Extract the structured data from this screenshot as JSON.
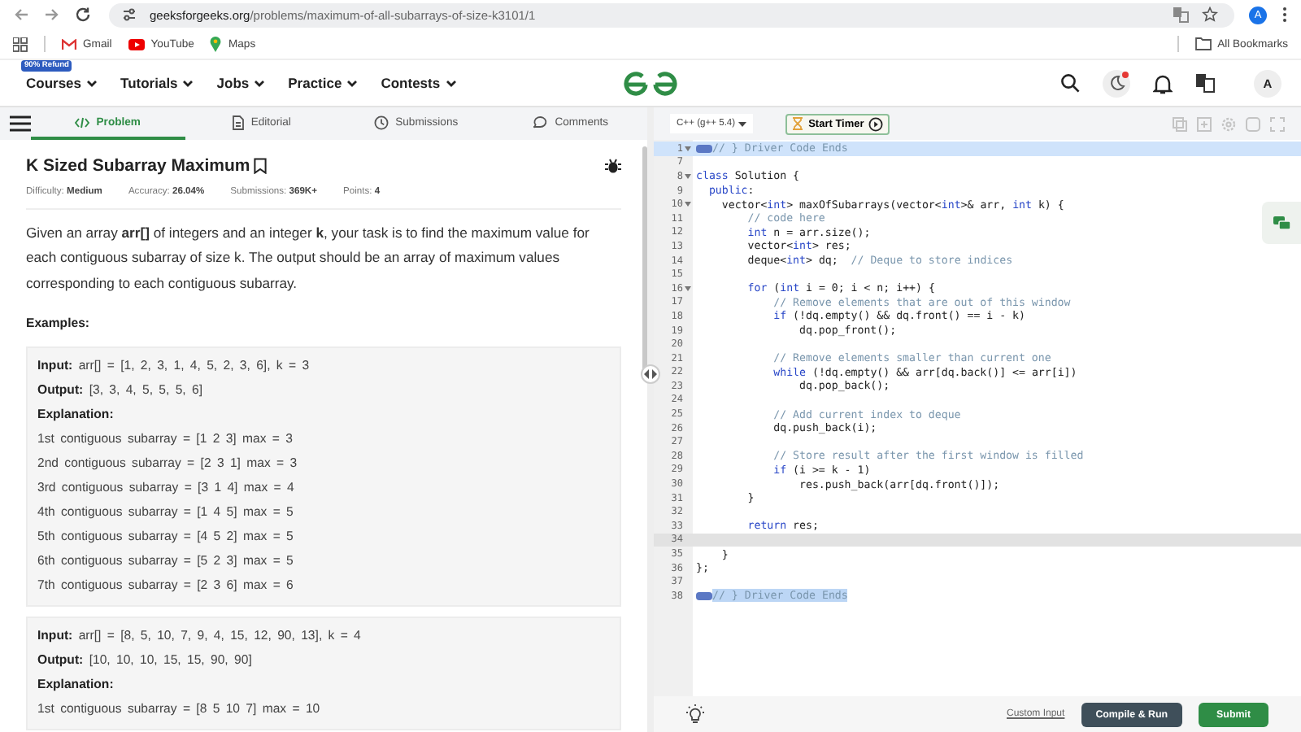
{
  "browser": {
    "url_host": "geeksforgeeks.org",
    "url_path": "/problems/maximum-of-all-subarrays-of-size-k3101/1",
    "profile_initial": "A"
  },
  "bookmarks": [
    {
      "label": "Gmail",
      "kind": "gmail"
    },
    {
      "label": "YouTube",
      "kind": "youtube"
    },
    {
      "label": "Maps",
      "kind": "maps"
    }
  ],
  "all_bookmarks": "All Bookmarks",
  "site_nav": {
    "badge": "90% Refund",
    "menus": [
      "Courses",
      "Tutorials",
      "Jobs",
      "Practice",
      "Contests"
    ],
    "notification_dot": true,
    "avatar": "A"
  },
  "problem_tabs": [
    {
      "label": "Problem",
      "kind": "code",
      "selected": true
    },
    {
      "label": "Editorial",
      "kind": "doc",
      "selected": false
    },
    {
      "label": "Submissions",
      "kind": "clock",
      "selected": false
    },
    {
      "label": "Comments",
      "kind": "chat",
      "selected": false
    }
  ],
  "problem": {
    "title": "K Sized Subarray Maximum",
    "meta": [
      {
        "label": "Difficulty:",
        "value": "Medium"
      },
      {
        "label": "Accuracy:",
        "value": "26.04%"
      },
      {
        "label": "Submissions:",
        "value": "369K+"
      },
      {
        "label": "Points:",
        "value": "4"
      }
    ],
    "description": "Given an array **arr[]** of integers and an integer **k**, your task is to find the maximum value for each contiguous subarray of size k. The output should be an array of maximum values corresponding to each contiguous subarray.",
    "examples_heading": "Examples:",
    "examples": [
      {
        "input_label": "Input:",
        "input": "arr[] = [1, 2, 3, 1, 4, 5, 2, 3, 6], k = 3",
        "output_label": "Output:",
        "output": "[3, 3, 4, 5, 5, 5, 6]",
        "explanation_label": "Explanation:",
        "explanation": [
          "1st contiguous subarray = [1 2 3] max = 3",
          "2nd contiguous subarray = [2 3 1] max = 3",
          "3rd contiguous subarray = [3 1 4] max = 4",
          "4th contiguous subarray = [1 4 5] max = 5",
          "5th contiguous subarray = [4 5 2] max = 5",
          "6th contiguous subarray = [5 2 3] max = 5",
          "7th contiguous subarray = [2 3 6] max = 6"
        ]
      },
      {
        "input_label": "Input:",
        "input": "arr[] = [8, 5, 10, 7, 9, 4, 15, 12, 90, 13], k = 4",
        "output_label": "Output:",
        "output": "[10, 10, 10, 15, 15, 90, 90]",
        "explanation_label": "Explanation:",
        "explanation": [
          "1st contiguous subarray = [8 5 10 7] max = 10"
        ]
      }
    ]
  },
  "editor": {
    "language": "C++ (g++ 5.4)",
    "timer_button": "Start Timer",
    "lines": [
      {
        "number": "1",
        "fold": true,
        "folded": true,
        "selected": true,
        "active": true,
        "parts": [
          {
            "kind": "comment",
            "text": "// } Driver Code Ends"
          }
        ]
      },
      {
        "number": "7",
        "fold": false,
        "folded": false,
        "selected": false,
        "active": false
      },
      {
        "number": "8",
        "fold": true,
        "folded": false,
        "selected": false,
        "active": false,
        "parts": [
          {
            "kind": "keyword",
            "text": "class"
          },
          {
            "kind": "plain",
            "text": " Solution {"
          }
        ]
      },
      {
        "number": "9",
        "fold": false,
        "folded": false,
        "selected": false,
        "active": false,
        "parts": [
          {
            "kind": "keyword",
            "text": "  public"
          },
          {
            "kind": "plain",
            "text": ":"
          }
        ]
      },
      {
        "number": "10",
        "fold": true,
        "folded": false,
        "selected": false,
        "active": false,
        "parts": [
          {
            "kind": "plain",
            "text": "    vector<"
          },
          {
            "kind": "keyword",
            "text": "int"
          },
          {
            "kind": "plain",
            "text": "> maxOfSubarrays(vector<"
          },
          {
            "kind": "keyword",
            "text": "int"
          },
          {
            "kind": "plain",
            "text": ">& arr, "
          },
          {
            "kind": "keyword",
            "text": "int"
          },
          {
            "kind": "plain",
            "text": " k) {"
          }
        ]
      },
      {
        "number": "11",
        "fold": false,
        "folded": false,
        "selected": false,
        "active": false,
        "parts": [
          {
            "kind": "comment",
            "text": "        // code here"
          }
        ]
      },
      {
        "number": "12",
        "fold": false,
        "folded": false,
        "selected": false,
        "active": false,
        "parts": [
          {
            "kind": "keyword",
            "text": "        int"
          },
          {
            "kind": "plain",
            "text": " n = arr.size();"
          }
        ]
      },
      {
        "number": "13",
        "fold": false,
        "folded": false,
        "selected": false,
        "active": false,
        "parts": [
          {
            "kind": "plain",
            "text": "        vector<"
          },
          {
            "kind": "keyword",
            "text": "int"
          },
          {
            "kind": "plain",
            "text": "> res;"
          }
        ]
      },
      {
        "number": "14",
        "fold": false,
        "folded": false,
        "selected": false,
        "active": false,
        "parts": [
          {
            "kind": "plain",
            "text": "        deque<"
          },
          {
            "kind": "keyword",
            "text": "int"
          },
          {
            "kind": "plain",
            "text": "> dq;  "
          },
          {
            "kind": "comment",
            "text": "// Deque to store indices"
          }
        ]
      },
      {
        "number": "15",
        "fold": false,
        "folded": false,
        "selected": false,
        "active": false
      },
      {
        "number": "16",
        "fold": true,
        "folded": false,
        "selected": false,
        "active": false,
        "parts": [
          {
            "kind": "keyword",
            "text": "        for"
          },
          {
            "kind": "plain",
            "text": " ("
          },
          {
            "kind": "keyword",
            "text": "int"
          },
          {
            "kind": "plain",
            "text": " i = 0; i < n; i++) {"
          }
        ]
      },
      {
        "number": "17",
        "fold": false,
        "folded": false,
        "selected": false,
        "active": false,
        "parts": [
          {
            "kind": "comment",
            "text": "            // Remove elements that are out of this window"
          }
        ]
      },
      {
        "number": "18",
        "fold": false,
        "folded": false,
        "selected": false,
        "active": false,
        "parts": [
          {
            "kind": "keyword",
            "text": "            if"
          },
          {
            "kind": "plain",
            "text": " (!dq.empty() && dq.front() == i - k)"
          }
        ]
      },
      {
        "number": "19",
        "fold": false,
        "folded": false,
        "selected": false,
        "active": false,
        "parts": [
          {
            "kind": "plain",
            "text": "                dq.pop_front();"
          }
        ]
      },
      {
        "number": "20",
        "fold": false,
        "folded": false,
        "selected": false,
        "active": false
      },
      {
        "number": "21",
        "fold": false,
        "folded": false,
        "selected": false,
        "active": false,
        "parts": [
          {
            "kind": "comment",
            "text": "            // Remove elements smaller than current one"
          }
        ]
      },
      {
        "number": "22",
        "fold": false,
        "folded": false,
        "selected": false,
        "active": false,
        "parts": [
          {
            "kind": "keyword",
            "text": "            while"
          },
          {
            "kind": "plain",
            "text": " (!dq.empty() && arr[dq.back()] <= arr[i])"
          }
        ]
      },
      {
        "number": "23",
        "fold": false,
        "folded": false,
        "selected": false,
        "active": false,
        "parts": [
          {
            "kind": "plain",
            "text": "                dq.pop_back();"
          }
        ]
      },
      {
        "number": "24",
        "fold": false,
        "folded": false,
        "selected": false,
        "active": false
      },
      {
        "number": "25",
        "fold": false,
        "folded": false,
        "selected": false,
        "active": false,
        "parts": [
          {
            "kind": "comment",
            "text": "            // Add current index to deque"
          }
        ]
      },
      {
        "number": "26",
        "fold": false,
        "folded": false,
        "selected": false,
        "active": false,
        "parts": [
          {
            "kind": "plain",
            "text": "            dq.push_back(i);"
          }
        ]
      },
      {
        "number": "27",
        "fold": false,
        "folded": false,
        "selected": false,
        "active": false
      },
      {
        "number": "28",
        "fold": false,
        "folded": false,
        "selected": false,
        "active": false,
        "parts": [
          {
            "kind": "comment",
            "text": "            // Store result after the first window is filled"
          }
        ]
      },
      {
        "number": "29",
        "fold": false,
        "folded": false,
        "selected": false,
        "active": false,
        "parts": [
          {
            "kind": "keyword",
            "text": "            if"
          },
          {
            "kind": "plain",
            "text": " (i >= k - 1)"
          }
        ]
      },
      {
        "number": "30",
        "fold": false,
        "folded": false,
        "selected": false,
        "active": false,
        "parts": [
          {
            "kind": "plain",
            "text": "                res.push_back(arr[dq.front()]);"
          }
        ]
      },
      {
        "number": "31",
        "fold": false,
        "folded": false,
        "selected": false,
        "active": false,
        "parts": [
          {
            "kind": "plain",
            "text": "        }"
          }
        ]
      },
      {
        "number": "32",
        "fold": false,
        "folded": false,
        "selected": false,
        "active": false
      },
      {
        "number": "33",
        "fold": false,
        "folded": false,
        "selected": false,
        "active": false,
        "parts": [
          {
            "kind": "keyword",
            "text": "        return"
          },
          {
            "kind": "plain",
            "text": " res;"
          }
        ]
      },
      {
        "number": "34",
        "fold": false,
        "folded": false,
        "selected": false,
        "active": true
      },
      {
        "number": "35",
        "fold": false,
        "folded": false,
        "selected": false,
        "active": false,
        "parts": [
          {
            "kind": "plain",
            "text": "    }"
          }
        ]
      },
      {
        "number": "36",
        "fold": false,
        "folded": false,
        "selected": false,
        "active": false,
        "parts": [
          {
            "kind": "plain",
            "text": "};"
          }
        ]
      },
      {
        "number": "37",
        "fold": false,
        "folded": false,
        "selected": false,
        "active": false
      },
      {
        "number": "38",
        "fold": false,
        "folded": true,
        "selected": true,
        "active": false,
        "parts": [
          {
            "kind": "comment",
            "text": "// } Driver Code Ends"
          }
        ]
      }
    ],
    "custom_input": "Custom Input",
    "compile_button": "Compile & Run",
    "submit_button": "Submit"
  }
}
